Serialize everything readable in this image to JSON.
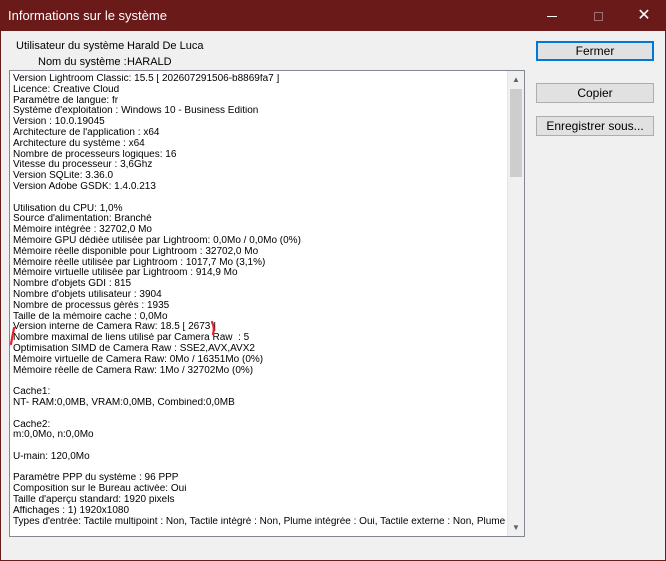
{
  "window": {
    "title": "Informations sur le système"
  },
  "header": {
    "user_label": "Utilisateur du système :",
    "user_value": "Harald De Luca",
    "machine_label": "Nom du système :",
    "machine_value": "HARALD"
  },
  "buttons": {
    "close": "Fermer",
    "copy": "Copier",
    "save": "Enregistrer sous..."
  },
  "info_lines": [
    "Version Lightroom Classic: 15.5 [ 202607291506-b8869fa7 ]",
    "Licence: Creative Cloud",
    "Paramètre de langue: fr",
    "Système d'exploitation : Windows 10 - Business Edition",
    "Version : 10.0.19045",
    "Architecture de l'application : x64",
    "Architecture du système : x64",
    "Nombre de processeurs logiques: 16",
    "Vitesse du processeur : 3,6Ghz",
    "Version SQLite: 3.36.0",
    "Version Adobe GSDK: 1.4.0.213",
    "",
    "Utilisation du CPU: 1,0%",
    "Source d'alimentation: Branché",
    "Mémoire intégrée : 32702,0 Mo",
    "Mémoire GPU dédiée utilisée par Lightroom: 0,0Mo / 0,0Mo (0%)",
    "Mémoire réelle disponible pour Lightroom : 32702,0 Mo",
    "Mémoire réelle utilisée par Lightroom : 1017,7 Mo (3,1%)",
    "Mémoire virtuelle utilisée par Lightroom : 914,9 Mo",
    "Nombre d'objets GDI : 815",
    "Nombre d'objets utilisateur : 3904",
    "Nombre de processus gérés : 1935",
    "Taille de la mémoire cache : 0,0Mo",
    "Version interne de Camera Raw: 18.5 [ 2673 ]",
    "Nombre maximal de liens utilisé par Camera Raw  : 5",
    "Optimisation SIMD de Camera Raw : SSE2,AVX,AVX2",
    "Mémoire virtuelle de Camera Raw: 0Mo / 16351Mo (0%)",
    "Mémoire réelle de Camera Raw: 1Mo / 32702Mo (0%)",
    "",
    "Cache1:",
    "NT- RAM:0,0MB, VRAM:0,0MB, Combined:0,0MB",
    "",
    "Cache2:",
    "m:0,0Mo, n:0,0Mo",
    "",
    "U-main: 120,0Mo",
    "",
    "Paramètre PPP du système : 96 PPP",
    "Composition sur le Bureau activée: Oui",
    "Taille d'aperçu standard: 1920 pixels",
    "Affichages : 1) 1920x1080",
    "Types d'entrée: Tactile multipoint : Non, Tactile intégré : Non, Plume intégrée : Oui, Tactile externe : Non, Plume"
  ],
  "colors": {
    "titlebar": "#6b1a1a",
    "annotation": "#e8202a",
    "default_button_border": "#0078d7"
  },
  "icons": {
    "minimize": "minimize-icon",
    "maximize": "maximize-icon",
    "close": "close-icon",
    "scroll_up": "scroll-up-arrow-icon",
    "scroll_down": "scroll-down-arrow-icon"
  },
  "glyphs": {
    "close": "✕",
    "scroll_up": "▲",
    "scroll_down": "▼"
  }
}
